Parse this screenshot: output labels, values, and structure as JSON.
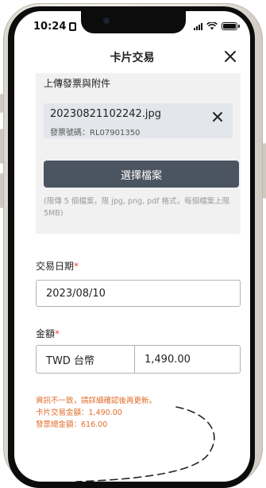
{
  "status_bar": {
    "time": "10:24"
  },
  "header": {
    "title": "卡片交易"
  },
  "upload": {
    "heading": "上傳發票與附件",
    "file": {
      "name": "20230821102242.jpg",
      "invoice_number": "發票號碼：RL07901350"
    },
    "choose_label": "選擇檔案",
    "hint": "(限傳 5 個檔案，限 jpg, png, pdf 格式，每個檔案上限 5MB)"
  },
  "date": {
    "label": "交易日期",
    "value": "2023/08/10"
  },
  "amount": {
    "label": "金額",
    "currency": "TWD 台幣",
    "value": "1,490.00"
  },
  "required_mark": "*",
  "warning": {
    "message": "資訊不一致，請詳細確認後再更新。",
    "card_amount": "卡片交易金額：1,490.00",
    "invoice_total": "發票總金額：616.00"
  },
  "colors": {
    "button": "#4b5561",
    "warning": "#e46a2a",
    "required": "#e94b3c"
  }
}
